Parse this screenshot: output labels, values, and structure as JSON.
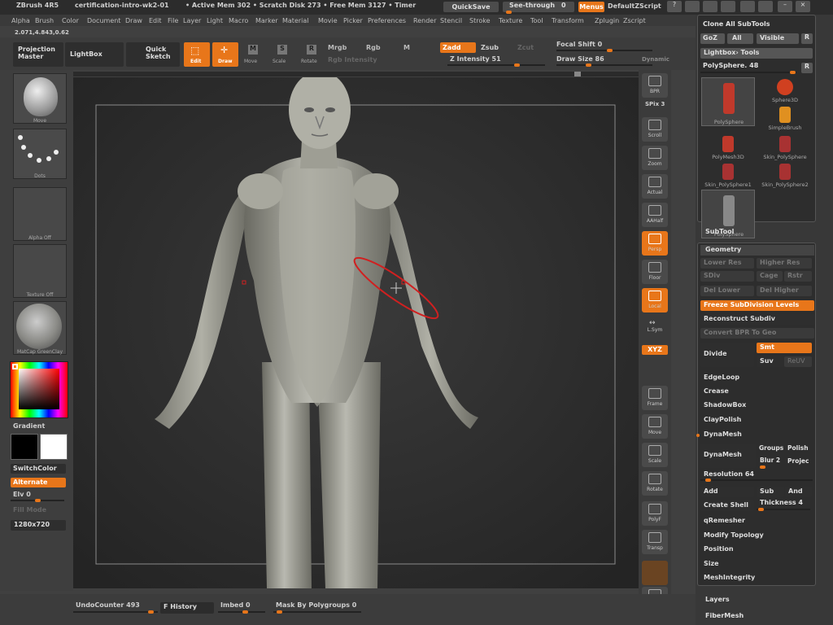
{
  "title": {
    "app": "ZBrush 4R5",
    "doc": "certification-intro-wk2-01",
    "mem": "• Active Mem 302 • Scratch Disk 273 • Free Mem 3127 • Timer"
  },
  "topbtns": {
    "quicksave": "QuickSave",
    "seethrough": "See-through",
    "seethrough_val": "0",
    "menus": "Menus",
    "zscript": "DefaultZScript"
  },
  "menus": [
    "Alpha",
    "Brush",
    "Color",
    "Document",
    "Draw",
    "Edit",
    "File",
    "Layer",
    "Light",
    "Macro",
    "Marker",
    "Material",
    "Movie",
    "Picker",
    "Preferences",
    "Render",
    "Stencil",
    "Stroke",
    "Texture",
    "Tool",
    "Transform",
    "Zplugin",
    "Zscript"
  ],
  "coords": "2.071,4.843,0.62",
  "toolbar": {
    "projection": "Projection\nMaster",
    "lightbox": "LightBox",
    "quicksketch": "Quick\nSketch",
    "edit": "Edit",
    "draw": "Draw",
    "move": "Move",
    "scale": "Scale",
    "rotate": "Rotate",
    "mrgb": "Mrgb",
    "rgb": "Rgb",
    "m": "M",
    "rgb_int": "Rgb Intensity",
    "zadd": "Zadd",
    "zsub": "Zsub",
    "zcut": "Zcut",
    "z_int": "Z Intensity 51",
    "focal": "Focal Shift 0",
    "drawsize": "Draw Size 86",
    "dynamic": "Dynamic"
  },
  "left": {
    "move": "Move",
    "dots": "Dots",
    "alpha": "Alpha Off",
    "texture": "Texture Off",
    "matcap": "MatCap GreenClay",
    "gradient": "Gradient",
    "switch": "SwitchColor",
    "alternate": "Alternate",
    "elv": "Elv 0",
    "fill": "Fill Mode",
    "res": "1280x720"
  },
  "right": {
    "bpr": "BPR",
    "spix": "SPix 3",
    "scroll": "Scroll",
    "zoom": "Zoom",
    "actual": "Actual",
    "aahalf": "AAHalf",
    "persp": "Persp",
    "floor": "Floor",
    "local": "Local",
    "lsym": "L.Sym",
    "xyz": "XYZ",
    "frame": "Frame",
    "move": "Move",
    "scale": "Scale",
    "rotate": "Rotate",
    "polyf": "PolyF",
    "transp": "Transp",
    "solo": "Solo"
  },
  "tool": {
    "clone": "Clone  All SubTools",
    "goz": "GoZ",
    "all": "All",
    "visible": "Visible",
    "r": "R",
    "lightboxtools": "Lightbox› Tools",
    "polysphere": "PolySphere. 48",
    "thumbs": [
      "PolySphere",
      "Sphere3D",
      "SimpleBrush",
      "PolyMesh3D",
      "Skin_PolySphere",
      "Skin_PolySphere1",
      "Skin_PolySphere2",
      "PolySphere"
    ],
    "subtool": "SubTool",
    "geometry": "Geometry",
    "lower": "Lower Res",
    "higher": "Higher Res",
    "sdiv": "SDiv",
    "cage": "Cage",
    "rstr": "Rstr",
    "dellower": "Del Lower",
    "delhigher": "Del Higher",
    "freeze": "Freeze SubDivision Levels",
    "reconstruct": "Reconstruct Subdiv",
    "convert": "Convert BPR To Geo",
    "divide": "Divide",
    "smt": "Smt",
    "suv": "Suv",
    "reuv": "ReUV",
    "edgeloop": "EdgeLoop",
    "crease": "Crease",
    "shadowbox": "ShadowBox",
    "claypolish": "ClayPolish",
    "dynamesh": "DynaMesh",
    "dynamesh_btn": "DynaMesh",
    "groups": "Groups",
    "polish": "Polish",
    "blur": "Blur 2",
    "project": "Projec",
    "resolution": "Resolution 64",
    "add": "Add",
    "sub": "Sub",
    "and": "And",
    "shell": "Create Shell",
    "thickness": "Thickness 4",
    "qremesher": "qRemesher",
    "modtopo": "Modify Topology",
    "position": "Position",
    "size": "Size",
    "meshint": "MeshIntegrity",
    "layers": "Layers",
    "fibermesh": "FiberMesh"
  },
  "bottom": {
    "undo": "UndoCounter 493",
    "history": "F History",
    "imbed": "Imbed 0",
    "mask": "Mask By Polygroups 0"
  },
  "colors": {
    "accent": "#e8761a",
    "bg": "#404040",
    "canvas": "#2d2d2d"
  }
}
